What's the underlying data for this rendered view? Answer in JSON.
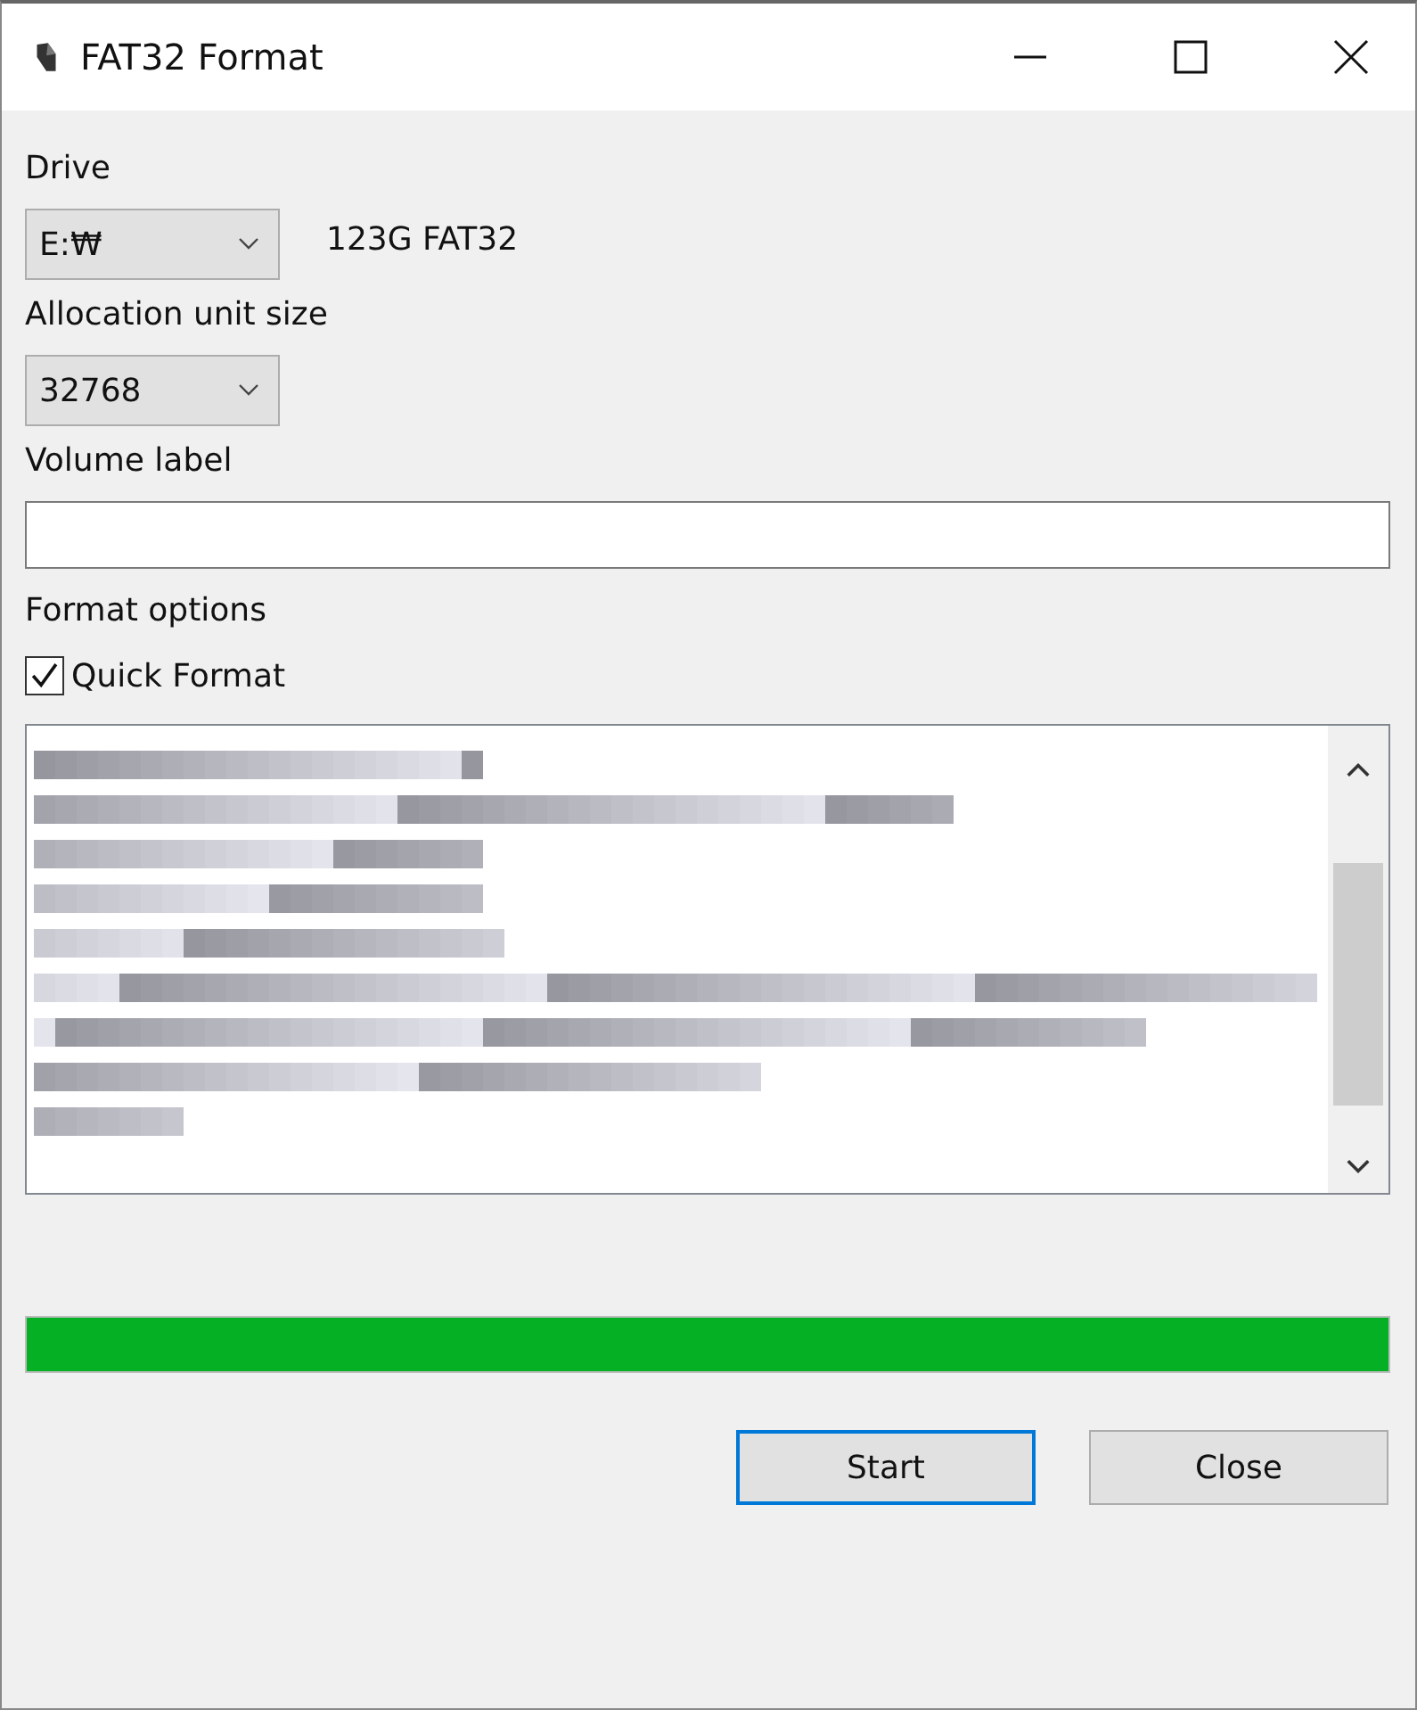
{
  "window": {
    "title": "FAT32 Format"
  },
  "drive": {
    "label": "Drive",
    "value": "E:₩",
    "info": "123G FAT32"
  },
  "allocation": {
    "label": "Allocation unit size",
    "value": "32768"
  },
  "volume_label": {
    "label": "Volume label"
  },
  "format_options": {
    "label": "Format options",
    "quick_format": {
      "label": "Quick Format",
      "checked": true
    }
  },
  "progress": {
    "level": 1.0
  },
  "buttons": [
    {
      "label": "Start",
      "kind": "default"
    },
    {
      "label": "Close",
      "kind": "normal"
    }
  ]
}
